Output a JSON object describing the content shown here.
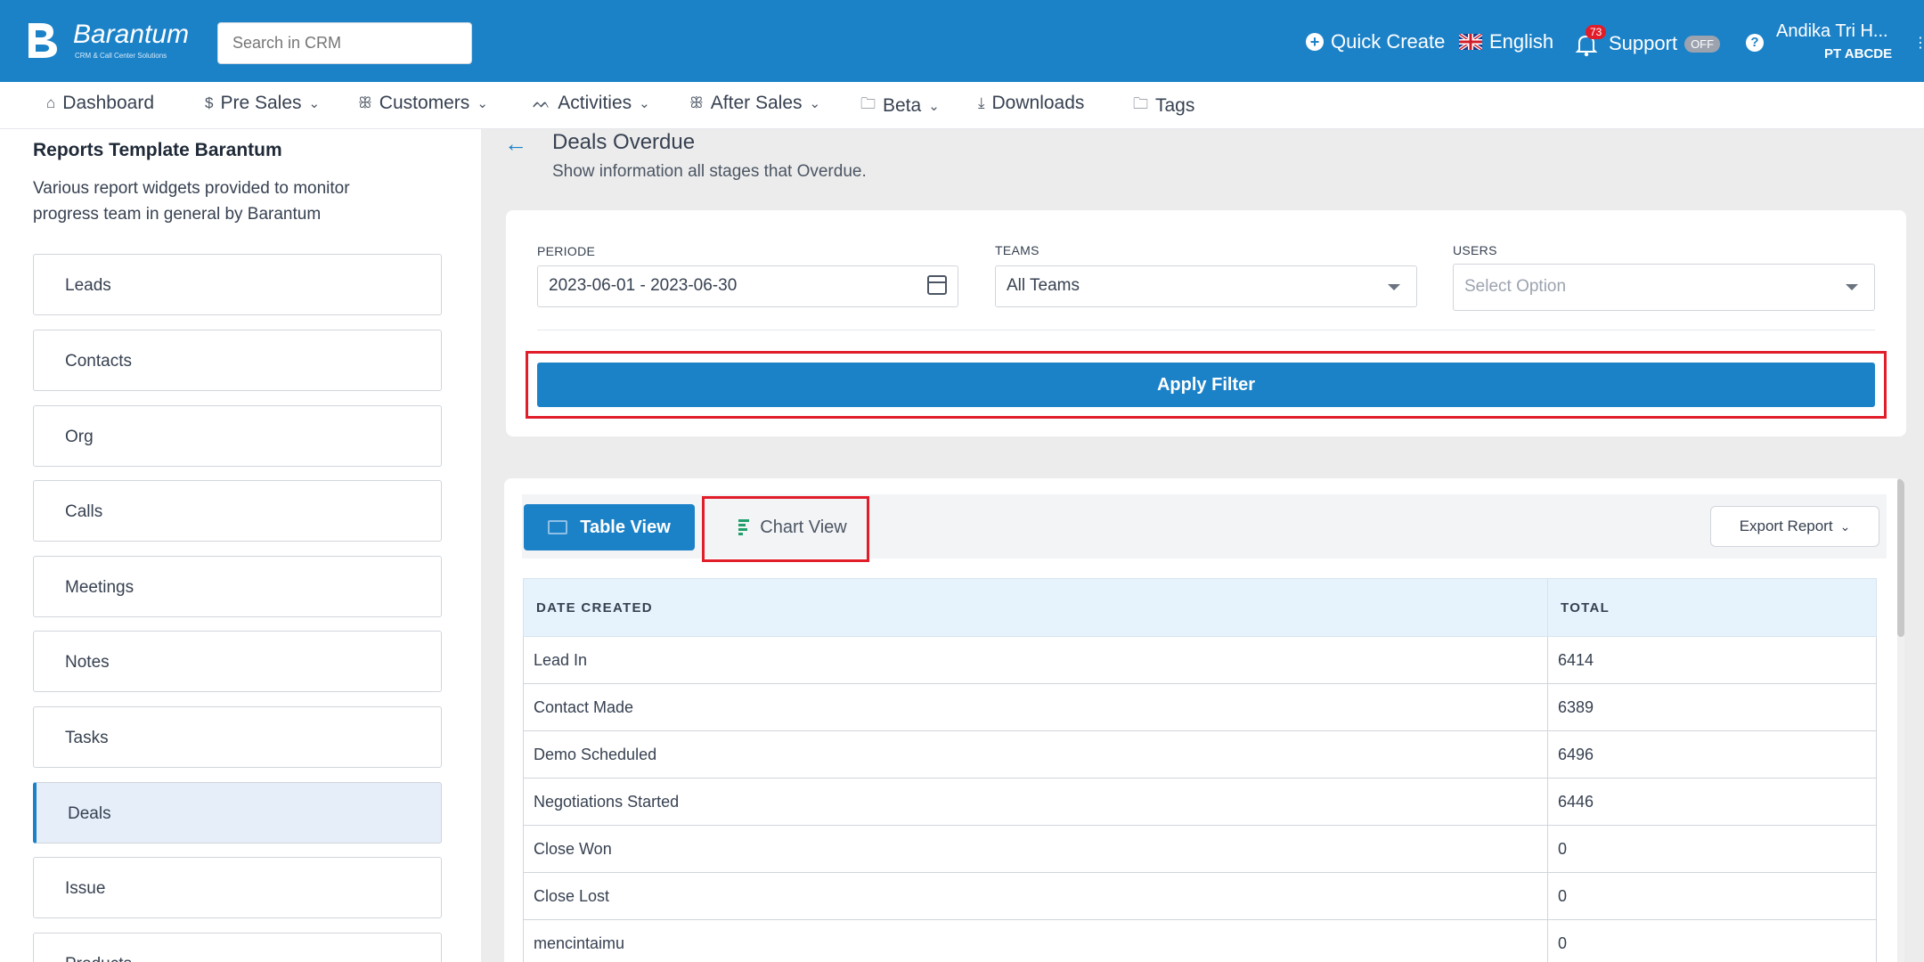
{
  "brand": {
    "name": "Barantum",
    "tagline": "CRM & Call Center Solutions"
  },
  "header": {
    "search_placeholder": "Search in CRM",
    "quick_create": "Quick Create",
    "language": "English",
    "notification_count": "73",
    "support_label": "Support",
    "support_toggle": "OFF",
    "help": "?",
    "user_name": "Andika Tri H...",
    "company": "PT ABCDE"
  },
  "nav": {
    "items": [
      {
        "label": "Dashboard",
        "icon": "home-icon",
        "dropdown": false
      },
      {
        "label": "Pre Sales",
        "icon": "dollar-icon",
        "dropdown": true
      },
      {
        "label": "Customers",
        "icon": "users-icon",
        "dropdown": true
      },
      {
        "label": "Activities",
        "icon": "activity-icon",
        "dropdown": true
      },
      {
        "label": "After Sales",
        "icon": "users-icon",
        "dropdown": true
      },
      {
        "label": "Beta",
        "icon": "folder-icon",
        "dropdown": true
      },
      {
        "label": "Downloads",
        "icon": "download-icon",
        "dropdown": false
      },
      {
        "label": "Tags",
        "icon": "folder-icon",
        "dropdown": false
      }
    ]
  },
  "sidebar": {
    "title": "Reports Template Barantum",
    "description": "Various report widgets provided to monitor progress team in general by Barantum",
    "items": [
      {
        "label": "Leads"
      },
      {
        "label": "Contacts"
      },
      {
        "label": "Org"
      },
      {
        "label": "Calls"
      },
      {
        "label": "Meetings"
      },
      {
        "label": "Notes"
      },
      {
        "label": "Tasks"
      },
      {
        "label": "Deals",
        "active": true
      },
      {
        "label": "Issue"
      },
      {
        "label": "Products"
      }
    ]
  },
  "page": {
    "title": "Deals Overdue",
    "subtitle": "Show information all stages that Overdue."
  },
  "filters": {
    "periode_label": "PERIODE",
    "periode_value": "2023-06-01 - 2023-06-30",
    "teams_label": "TEAMS",
    "teams_value": "All Teams",
    "users_label": "USERS",
    "users_placeholder": "Select Option",
    "apply_label": "Apply Filter"
  },
  "report": {
    "table_view_label": "Table View",
    "chart_view_label": "Chart View",
    "export_label": "Export Report",
    "columns": [
      "DATE CREATED",
      "TOTAL"
    ],
    "rows": [
      {
        "stage": "Lead In",
        "total": "6414"
      },
      {
        "stage": "Contact Made",
        "total": "6389"
      },
      {
        "stage": "Demo Scheduled",
        "total": "6496"
      },
      {
        "stage": "Negotiations Started",
        "total": "6446"
      },
      {
        "stage": "Close Won",
        "total": "0"
      },
      {
        "stage": "Close Lost",
        "total": "0"
      },
      {
        "stage": "mencintaimu",
        "total": "0"
      }
    ]
  },
  "colors": {
    "primary": "#1c82c8",
    "highlight_border": "#e11d2a",
    "table_header_bg": "#e6f2fc"
  }
}
